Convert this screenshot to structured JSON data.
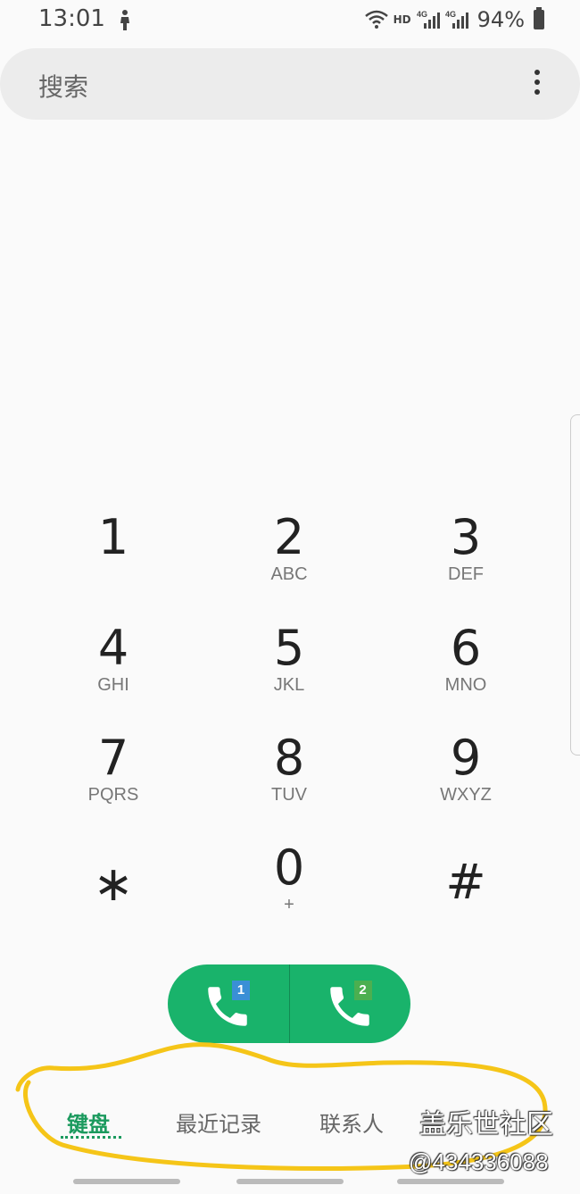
{
  "status_bar": {
    "time": "13:01",
    "hd": "HD",
    "battery": "94%",
    "icons": [
      "notification-figure-icon",
      "wifi-icon",
      "signal-4g-icon",
      "signal-4g-icon",
      "battery-icon"
    ]
  },
  "search": {
    "placeholder": "搜索",
    "menu_icon": "more-vert-icon"
  },
  "keypad": [
    {
      "digit": "1",
      "letters": ""
    },
    {
      "digit": "2",
      "letters": "ABC"
    },
    {
      "digit": "3",
      "letters": "DEF"
    },
    {
      "digit": "4",
      "letters": "GHI"
    },
    {
      "digit": "5",
      "letters": "JKL"
    },
    {
      "digit": "6",
      "letters": "MNO"
    },
    {
      "digit": "7",
      "letters": "PQRS"
    },
    {
      "digit": "8",
      "letters": "TUV"
    },
    {
      "digit": "9",
      "letters": "WXYZ"
    },
    {
      "digit": "∗",
      "letters": ""
    },
    {
      "digit": "0",
      "letters": "+"
    },
    {
      "digit": "#",
      "letters": ""
    }
  ],
  "call_buttons": [
    {
      "sim": "1",
      "icon": "phone-icon",
      "badge_color": "#3a8fd6"
    },
    {
      "sim": "2",
      "icon": "phone-icon",
      "badge_color": "#4caf50"
    }
  ],
  "tabs": [
    {
      "label": "键盘",
      "active": true
    },
    {
      "label": "最近记录",
      "active": false
    },
    {
      "label": "联系人",
      "active": false
    },
    {
      "label": "",
      "active": false
    }
  ],
  "watermark": {
    "line1": "盖乐世社区",
    "line2": "@434336088"
  },
  "colors": {
    "accent": "#1b9a5e",
    "call_button": "#19b36b",
    "highlight": "#f5c518"
  }
}
